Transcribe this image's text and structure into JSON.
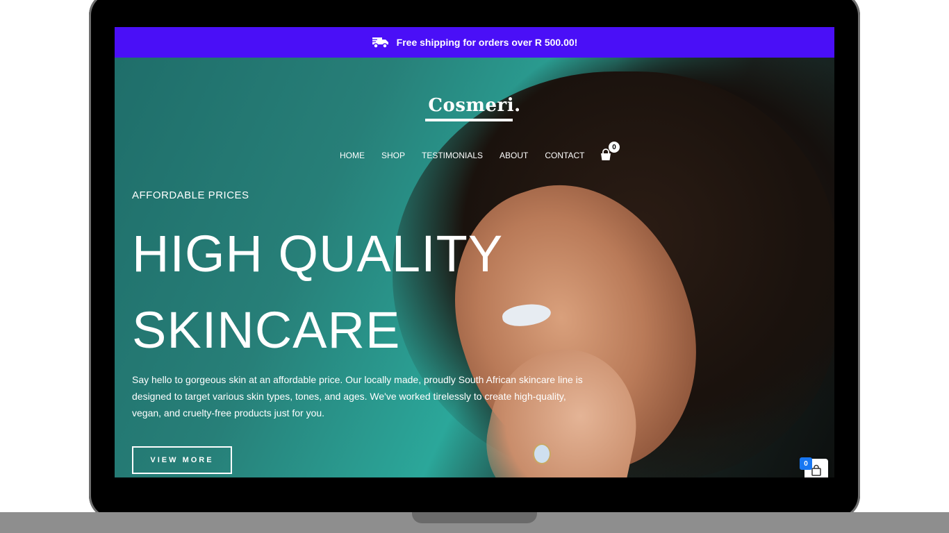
{
  "promo": {
    "text": "Free shipping for orders over R 500.00!",
    "icon": "truck-icon"
  },
  "brand": {
    "logo": "Cosmeri."
  },
  "nav": {
    "items": [
      "HOME",
      "SHOP",
      "TESTIMONIALS",
      "ABOUT",
      "CONTACT"
    ]
  },
  "cart": {
    "count": "0",
    "icon": "shopping-bag-icon"
  },
  "hero": {
    "eyebrow": "AFFORDABLE PRICES",
    "headline_line1": "HIGH QUALITY",
    "headline_line2": "SKINCARE",
    "description": "Say hello to gorgeous skin at an affordable price. Our locally made, proudly South African skincare line is designed to target various skin types, tones, and ages. We've worked tirelessly to create high-quality, vegan, and cruelty-free products just for you.",
    "cta_label": "VIEW MORE"
  },
  "floating_cart": {
    "count": "0",
    "icon": "bag-icon"
  },
  "colors": {
    "promo_bar": "#4a0ff7",
    "float_badge": "#1877f2"
  }
}
